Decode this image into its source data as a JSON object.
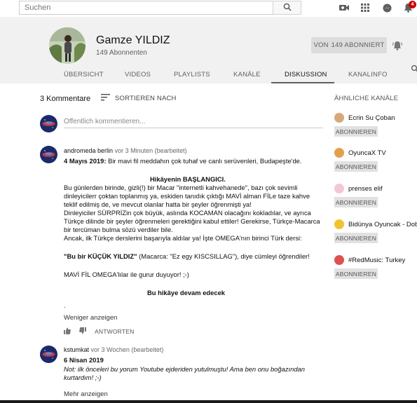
{
  "topbar": {
    "search_placeholder": "Suchen",
    "notification_count": "4",
    "icons": [
      "search-icon",
      "camera-icon",
      "apps-icon",
      "messages-icon",
      "bell-icon"
    ]
  },
  "channel": {
    "name": "Gamze YILDIZ",
    "subscribers": "149 Abonnenten",
    "subscribe_label": "VON",
    "subscribe_count": "149 ABONNIERT"
  },
  "tabs": [
    {
      "label": "ÜBERSICHT"
    },
    {
      "label": "VIDEOS"
    },
    {
      "label": "PLAYLISTS"
    },
    {
      "label": "KANÄLE"
    },
    {
      "label": "DISKUSSION",
      "active": true
    },
    {
      "label": "KANALINFO"
    }
  ],
  "comments_header": {
    "count": "3 Kommentare",
    "sort_label": "SORTIEREN NACH",
    "composer_placeholder": "Öffentlich kommentieren..."
  },
  "comment1": {
    "author": "andromeda berlin",
    "meta": "vor 3 Minuten (bearbeitet)",
    "date": "4 Mayıs 2019:",
    "line1": "Bir mavi fil meddahın çok tuhaf ve canlı serüvenleri, Budapeşte'de.",
    "heading": "Hikâyenin BAŞLANGICI.",
    "p1": [
      "Bu günlerden birinde, gizli(!) bir Macar \"internetli kahvehanede\", bazı çok sevimli",
      "dinleyicilerr çoktan toplanmış ya, eskiden tanıdık çıktığı MAVİ alman FİLe taze kahve",
      "teklif edilmiş de, ve mevcut olanlar hatta bir şeyler öğrenmişti ya!",
      "Dinleyiciler SÜRPRİZin çok büyük, aslında KOCAMAN olacağını kokladılar, ve ayrıca",
      "Türkçe dilinde bir şeyler öğrenmeleri gerektiğini kabul ettiler! Gerekirse, Türkçe-Macarca",
      "bir tercüman bulma sözü verdiler bile.",
      "Ancak, ilk Türkçe derslerini başarıyla aldılar ya! İşte OMEGA'nın birinci Türk dersi:"
    ],
    "quote_bold": "\"Bu bir KÜÇÜK YILDIZ\"",
    "quote_rest": " (Macarca: \"Ez egy KISCSILLAG\"), diye cümleyi öğrendiler!",
    "line_omega": "MAVİ FİL OMEGA'lılar ile gurur duyuyor! ;-)",
    "continued": "Bu hikâye devam edecek",
    "dot": ".",
    "less_label": "Weniger anzeigen",
    "reply_label": "ANTWORTEN"
  },
  "comment2": {
    "author": "kstumkat",
    "meta": "vor 3 Wochen (bearbeitet)",
    "date": "6 Nisan 2019",
    "line1": "Not: ilk önceleri bu yorum Youtube ejderiden yutulmuştu! Ama ben onu boğazından",
    "line2": "kurtardım! ;-)",
    "more_label": "Mehr anzeigen"
  },
  "sidebar": {
    "title": "ÄHNLICHE KANÄLE",
    "button_label": "ABONNIEREN",
    "channels": [
      {
        "name": "Ecrin Su Çoban",
        "color": "#d9a77c"
      },
      {
        "name": "OyuncaX TV",
        "color": "#e3a04a"
      },
      {
        "name": "prenses elif",
        "color": "#f3c7d6"
      },
      {
        "name": "Bidünya Oyuncak - Dob...",
        "color": "#f2c230"
      },
      {
        "name": "#RedMusic: Turkey",
        "color": "#e05050"
      }
    ]
  }
}
